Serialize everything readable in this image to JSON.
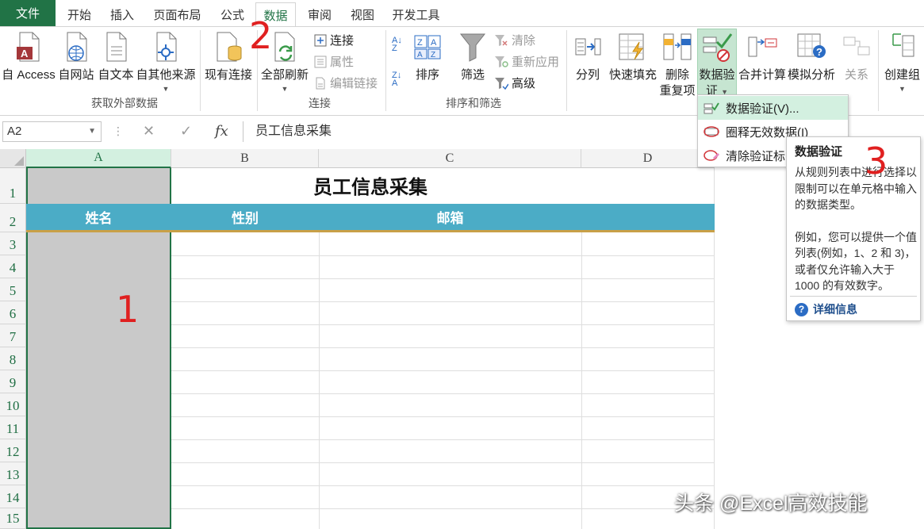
{
  "tabs": {
    "file": "文件",
    "items": [
      "开始",
      "插入",
      "页面布局",
      "公式",
      "数据",
      "审阅",
      "视图",
      "开发工具"
    ],
    "active": "数据"
  },
  "ribbon": {
    "get_external": {
      "buttons": [
        "自 Access",
        "自网站",
        "自文本",
        "自其他来源"
      ],
      "label": "获取外部数据"
    },
    "existing_conn": "现有连接",
    "connections": {
      "refresh_all": "全部刷新",
      "connect": "连接",
      "properties": "属性",
      "edit_links": "编辑链接",
      "label": "连接"
    },
    "sort_filter": {
      "sort": "排序",
      "filter": "筛选",
      "clear": "清除",
      "reapply": "重新应用",
      "advanced": "高级",
      "label": "排序和筛选"
    },
    "data_tools": {
      "text_to_columns": "分列",
      "flash_fill": "快速填充",
      "remove_dup_1": "删除",
      "remove_dup_2": "重复项",
      "validation_1": "数据验",
      "validation_2": "证",
      "consolidate": "合并计算",
      "whatif": "模拟分析",
      "relationships": "关系"
    },
    "outline": {
      "group": "创建组"
    }
  },
  "formula_bar": {
    "name_box": "A2",
    "cancel": "✕",
    "enter": "✓",
    "fx": "fx",
    "content": "员工信息采集"
  },
  "grid": {
    "columns": [
      "A",
      "B",
      "C",
      "D"
    ],
    "rows": [
      "1",
      "2",
      "3",
      "4",
      "5",
      "6",
      "7",
      "8",
      "9",
      "10",
      "11",
      "12",
      "13",
      "14",
      "15"
    ],
    "title": "员工信息采集",
    "headers": [
      "姓名",
      "性别",
      "邮箱"
    ]
  },
  "menu": {
    "items": [
      "数据验证(V)...",
      "圈释无效数据(I)",
      "清除验证标"
    ]
  },
  "tooltip": {
    "title": "数据验证",
    "para1": "从规则列表中进行选择以限制可以在单元格中输入的数据类型。",
    "para2": "例如，您可以提供一个值列表(例如，1、2 和 3)，或者仅允许输入大于 1000 的有效数字。",
    "link": "详细信息"
  },
  "annotations": [
    "1",
    "2",
    "3"
  ],
  "watermark": "头条 @Excel高效技能",
  "colors": {
    "excel_green": "#217346",
    "header_blue": "#4bacc6",
    "header_rule": "#c9a047",
    "selection_gray": "#c9c9c9",
    "annotation_red": "#e02020"
  }
}
